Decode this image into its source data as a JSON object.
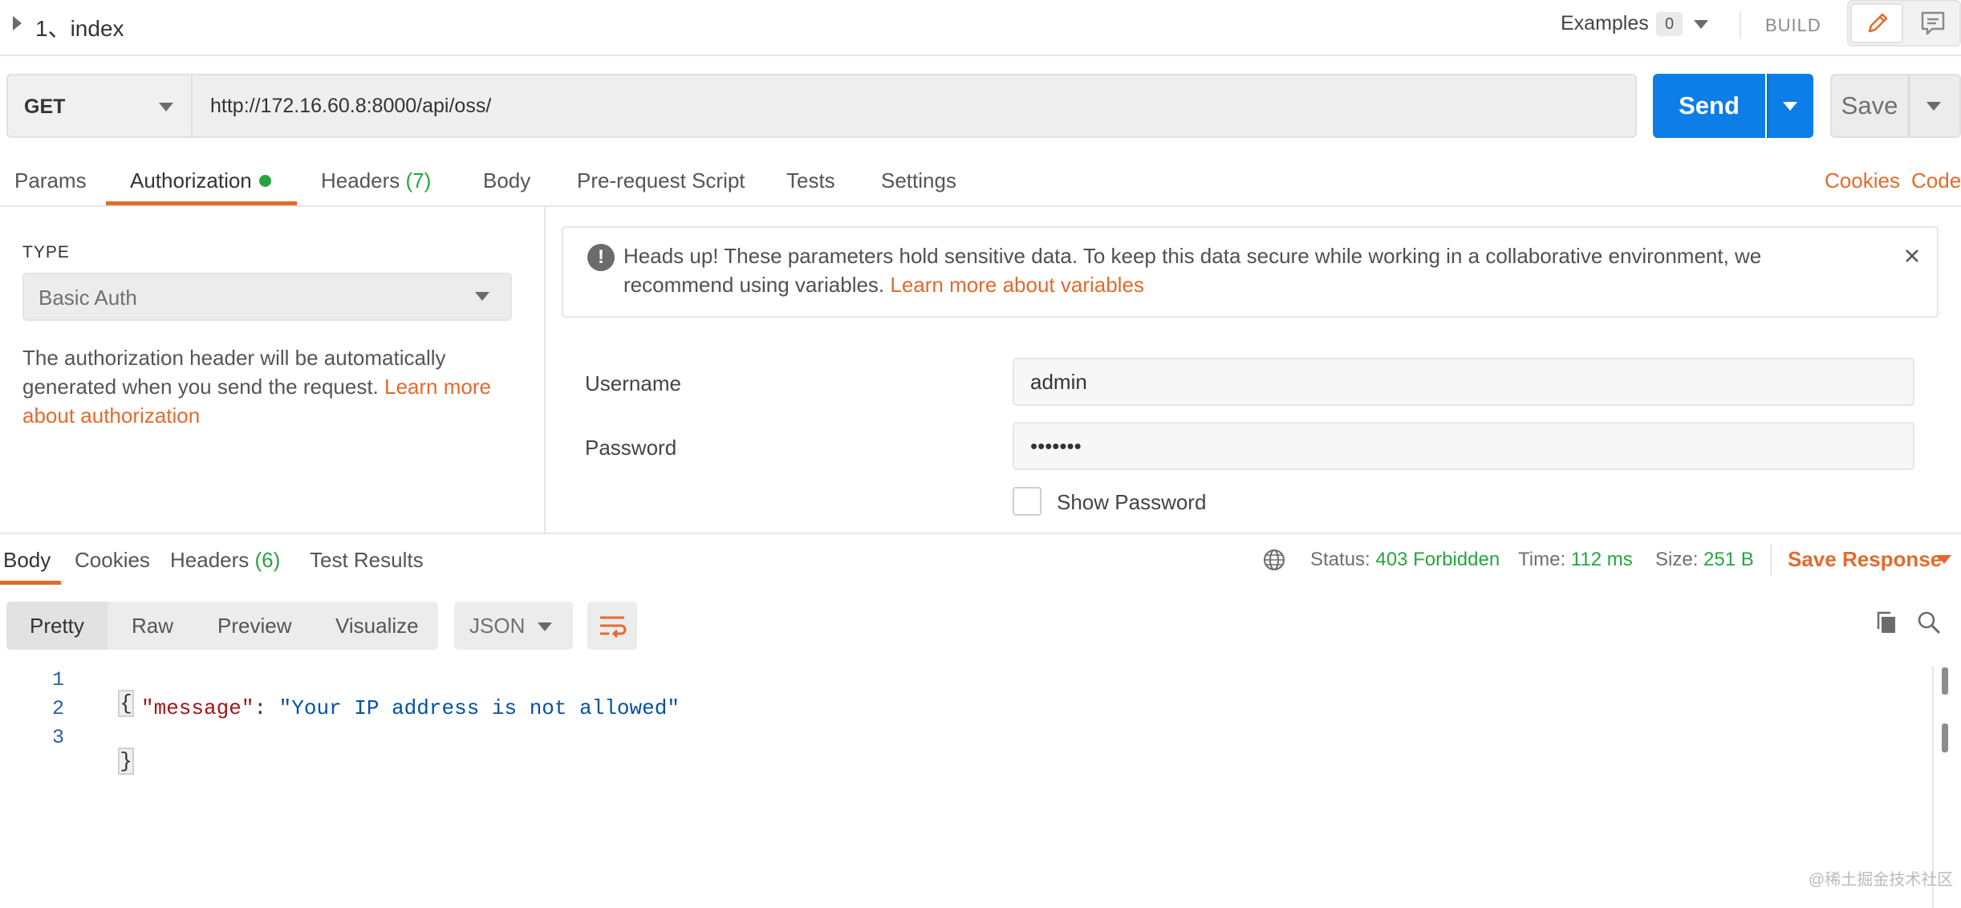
{
  "request": {
    "title": "1、index",
    "examples_label": "Examples",
    "examples_count": "0",
    "build_label": "BUILD",
    "method": "GET",
    "url": "http://172.16.60.8:8000/api/oss/",
    "send_label": "Send",
    "save_label": "Save"
  },
  "req_tabs": {
    "params": "Params",
    "authorization": "Authorization",
    "headers": "Headers",
    "headers_count": "(7)",
    "body": "Body",
    "prerequest": "Pre-request Script",
    "tests": "Tests",
    "settings": "Settings",
    "cookies": "Cookies",
    "code": "Code"
  },
  "auth": {
    "type_label": "TYPE",
    "type_value": "Basic Auth",
    "help_text": "The authorization header will be automatically generated when you send the request. ",
    "help_link": "Learn more about authorization",
    "alert_text": "Heads up! These parameters hold sensitive data. To keep this data secure while working in a collaborative environment, we recommend using variables. ",
    "alert_link": "Learn more about variables",
    "username_label": "Username",
    "username_value": "admin",
    "password_label": "Password",
    "password_value": "•••••••",
    "show_password_label": "Show Password"
  },
  "resp_tabs": {
    "body": "Body",
    "cookies": "Cookies",
    "headers": "Headers",
    "headers_count": "(6)",
    "test_results": "Test Results"
  },
  "status": {
    "status_key": "Status:",
    "status_value": "403 Forbidden",
    "time_key": "Time:",
    "time_value": "112 ms",
    "size_key": "Size:",
    "size_value": "251 B",
    "save_response": "Save Response"
  },
  "view": {
    "pretty": "Pretty",
    "raw": "Raw",
    "preview": "Preview",
    "visualize": "Visualize",
    "format": "JSON"
  },
  "code": {
    "line_numbers": [
      "1",
      "2",
      "3"
    ],
    "open_brace": "{",
    "close_brace": "}",
    "key": "\"message\"",
    "colon": ": ",
    "value": "\"Your IP address is not allowed\""
  },
  "watermark": "@稀土掘金技术社区",
  "colors": {
    "accent": "#e36a2d",
    "send_blue": "#0d7ee8",
    "status_green": "#26a541"
  },
  "icons": {
    "collapse": "caret-right-icon",
    "edit": "pencil-icon",
    "comment": "comment-icon",
    "alert": "exclamation-circle-icon",
    "close": "close-icon",
    "globe": "globe-icon",
    "wrap": "wrap-lines-icon",
    "copy": "copy-icon",
    "search": "search-icon"
  }
}
